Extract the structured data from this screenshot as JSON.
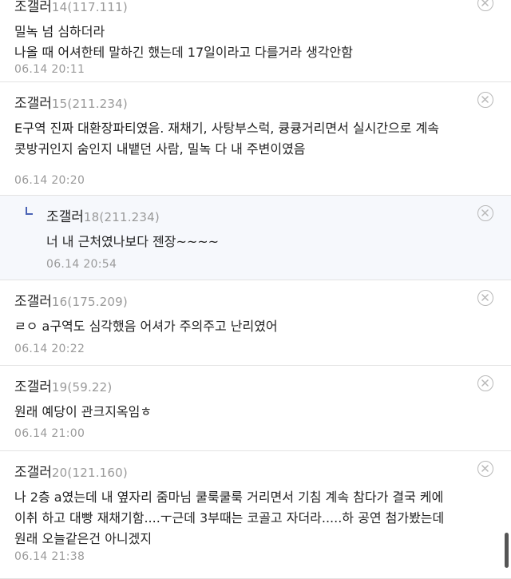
{
  "comments": [
    {
      "nickname": "조갤러",
      "meta": "14(117.111)",
      "lines": "밀녹 넘 심하더라\n나올 때 어셔한테 말하긴 했는데 17일이라고 다를거라 생각안함",
      "date": "06.14 20:11"
    },
    {
      "nickname": "조갤러",
      "meta": "15(211.234)",
      "lines": "E구역 진짜 대환장파티였음. 재채기, 사탕부스럭, 큥큥거리면서 실시간으로 계속\n콧방귀인지 숨인지 내뱉던 사람, 밀녹 다 내 주변이였음",
      "date": "06.14 20:20"
    },
    {
      "nickname": "조갤러",
      "meta": "18(211.234)",
      "lines": "너 내 근처였나보다 젠장~~~~",
      "date": "06.14 20:54"
    },
    {
      "nickname": "조갤러",
      "meta": "16(175.209)",
      "lines": "ㄹㅇ a구역도 심각했음 어셔가 주의주고 난리였어",
      "date": "06.14 20:22"
    },
    {
      "nickname": "조갤러",
      "meta": "19(59.22)",
      "lines": "원래 예당이 관크지옥임ㅎ",
      "date": "06.14 21:00"
    },
    {
      "nickname": "조갤러",
      "meta": "20(121.160)",
      "lines": "나 2층 a였는데 내 옆자리 줌마님 쿨룩쿨룩 거리면서 기침 계속 참다가 결국 케에\n이취 하고 대빵 재채기함....ㅜ근데 3부때는 코골고 자더라.....하 공연 첨가봤는데\n원래 오늘같은건 아니겠지",
      "date": "06.14 21:38"
    }
  ]
}
